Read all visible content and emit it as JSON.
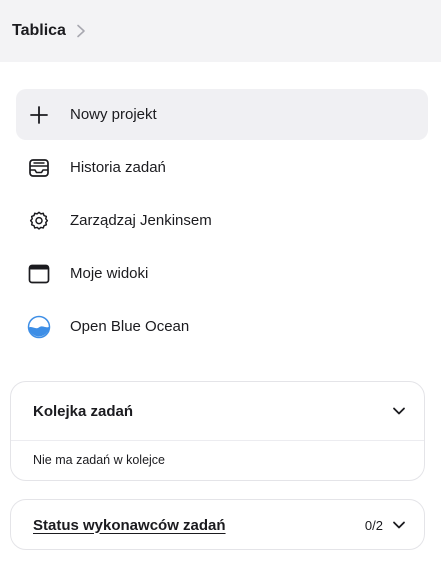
{
  "breadcrumb": {
    "items": [
      {
        "label": "Tablica"
      }
    ]
  },
  "nav": {
    "items": [
      {
        "label": "Nowy projekt",
        "icon": "plus-icon",
        "active": true
      },
      {
        "label": "Historia zadań",
        "icon": "inbox-icon"
      },
      {
        "label": "Zarządzaj Jenkinsem",
        "icon": "gear-icon"
      },
      {
        "label": "Moje widoki",
        "icon": "window-icon"
      },
      {
        "label": "Open Blue Ocean",
        "icon": "blue-ocean-icon"
      }
    ]
  },
  "queue": {
    "title": "Kolejka zadań",
    "empty_text": "Nie ma zadań w kolejce"
  },
  "executors": {
    "title": "Status wykonawców zadań",
    "count": "0/2"
  },
  "colors": {
    "breadcrumb_bg": "#f3f3f5",
    "active_item_bg": "#f0f0f3",
    "blue_ocean": "#3d8ee6"
  }
}
